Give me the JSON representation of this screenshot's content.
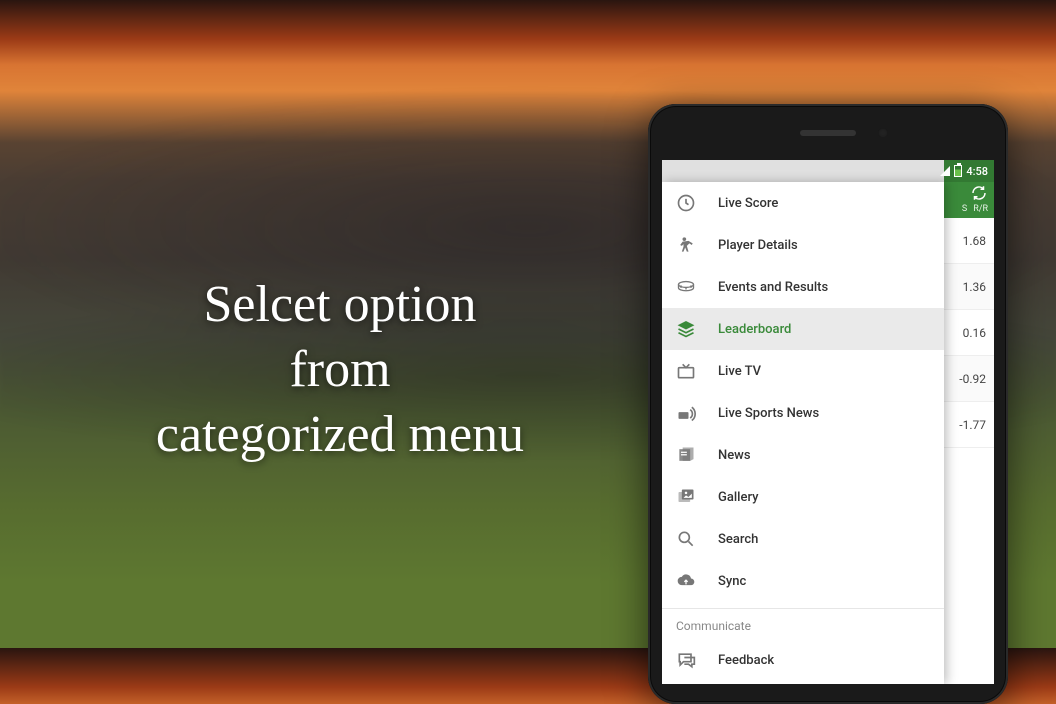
{
  "promo": {
    "line1": "Selcet option",
    "line2": "from",
    "line3": "categorized menu"
  },
  "statusbar": {
    "time": "4:58"
  },
  "drawer": {
    "items": [
      {
        "label": "Live Score",
        "icon": "clock",
        "selected": false
      },
      {
        "label": "Player Details",
        "icon": "player",
        "selected": false
      },
      {
        "label": "Events and Results",
        "icon": "stadium",
        "selected": false
      },
      {
        "label": "Leaderboard",
        "icon": "layers",
        "selected": true
      },
      {
        "label": "Live TV",
        "icon": "tv",
        "selected": false
      },
      {
        "label": "Live Sports News",
        "icon": "broadcast",
        "selected": false
      },
      {
        "label": "News",
        "icon": "newspaper",
        "selected": false
      },
      {
        "label": "Gallery",
        "icon": "gallery",
        "selected": false
      },
      {
        "label": "Search",
        "icon": "search",
        "selected": false
      },
      {
        "label": "Sync",
        "icon": "cloud-sync",
        "selected": false
      }
    ],
    "section_label": "Communicate",
    "section_items": [
      {
        "label": "Feedback",
        "icon": "chat",
        "selected": false
      }
    ]
  },
  "right_panel": {
    "header_col1": "S",
    "header_col2": "R/R",
    "rows": [
      "1.68",
      "1.36",
      "0.16",
      "-0.92",
      "-1.77"
    ]
  },
  "colors": {
    "accent": "#3a8a3a"
  }
}
